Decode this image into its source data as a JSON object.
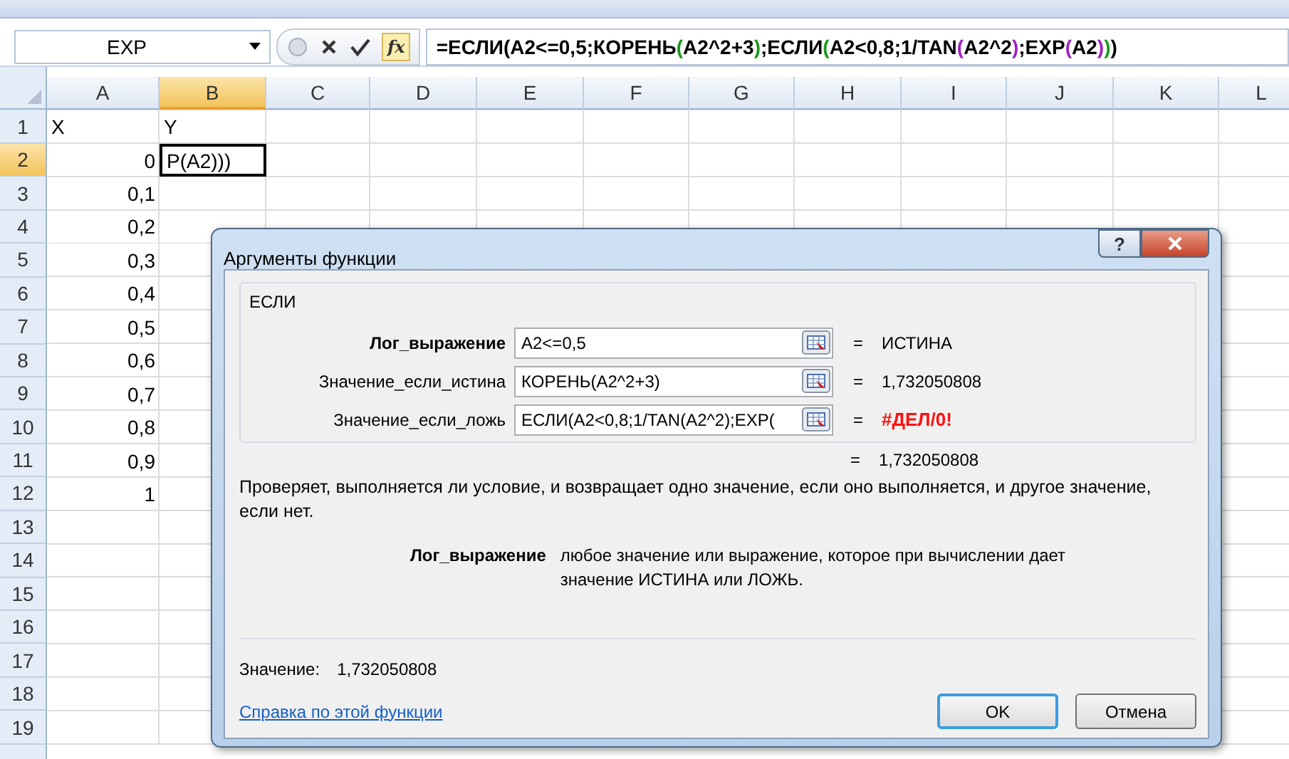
{
  "name_box": {
    "value": "EXP"
  },
  "fx_button": {
    "label": "fx"
  },
  "formula": [
    {
      "text": "=ЕСЛИ(A2<=0,5;КОРЕНЬ",
      "color": "#000000"
    },
    {
      "text": "(",
      "color": "#1a9a1a"
    },
    {
      "text": "A2^2+3",
      "color": "#000000"
    },
    {
      "text": ")",
      "color": "#1a9a1a"
    },
    {
      "text": ";ЕСЛИ",
      "color": "#000000"
    },
    {
      "text": "(",
      "color": "#1a9a1a"
    },
    {
      "text": "A2<0,8;1/TAN",
      "color": "#000000"
    },
    {
      "text": "(",
      "color": "#a020c0"
    },
    {
      "text": "A2^2",
      "color": "#000000"
    },
    {
      "text": ")",
      "color": "#a020c0"
    },
    {
      "text": ";EXP",
      "color": "#000000"
    },
    {
      "text": "(",
      "color": "#a020c0"
    },
    {
      "text": "A2",
      "color": "#000000"
    },
    {
      "text": ")",
      "color": "#a020c0"
    },
    {
      "text": ")",
      "color": "#1a9a1a"
    },
    {
      "text": ")",
      "color": "#000000"
    }
  ],
  "columns": [
    {
      "label": "A",
      "selected": false
    },
    {
      "label": "B",
      "selected": true
    },
    {
      "label": "C",
      "selected": false
    },
    {
      "label": "D",
      "selected": false
    },
    {
      "label": "E",
      "selected": false
    },
    {
      "label": "F",
      "selected": false
    },
    {
      "label": "G",
      "selected": false
    },
    {
      "label": "H",
      "selected": false
    },
    {
      "label": "I",
      "selected": false
    },
    {
      "label": "J",
      "selected": false
    },
    {
      "label": "K",
      "selected": false
    },
    {
      "label": "L",
      "selected": false
    }
  ],
  "rows": [
    {
      "header": "1",
      "selected": false,
      "cells": [
        {
          "text": "X",
          "kind": "text",
          "active": false
        },
        {
          "text": "Y",
          "kind": "text",
          "active": false
        }
      ]
    },
    {
      "header": "2",
      "selected": true,
      "cells": [
        {
          "text": "0",
          "kind": "number",
          "active": false
        },
        {
          "text": "P(A2)))",
          "kind": "text",
          "active": true
        }
      ]
    },
    {
      "header": "3",
      "selected": false,
      "cells": [
        {
          "text": "0,1",
          "kind": "number",
          "active": false
        }
      ]
    },
    {
      "header": "4",
      "selected": false,
      "cells": [
        {
          "text": "0,2",
          "kind": "number",
          "active": false
        }
      ]
    },
    {
      "header": "5",
      "selected": false,
      "cells": [
        {
          "text": "0,3",
          "kind": "number",
          "active": false
        }
      ]
    },
    {
      "header": "6",
      "selected": false,
      "cells": [
        {
          "text": "0,4",
          "kind": "number",
          "active": false
        }
      ]
    },
    {
      "header": "7",
      "selected": false,
      "cells": [
        {
          "text": "0,5",
          "kind": "number",
          "active": false
        }
      ]
    },
    {
      "header": "8",
      "selected": false,
      "cells": [
        {
          "text": "0,6",
          "kind": "number",
          "active": false
        }
      ]
    },
    {
      "header": "9",
      "selected": false,
      "cells": [
        {
          "text": "0,7",
          "kind": "number",
          "active": false
        }
      ]
    },
    {
      "header": "10",
      "selected": false,
      "cells": [
        {
          "text": "0,8",
          "kind": "number",
          "active": false
        }
      ]
    },
    {
      "header": "11",
      "selected": false,
      "cells": [
        {
          "text": "0,9",
          "kind": "number",
          "active": false
        }
      ]
    },
    {
      "header": "12",
      "selected": false,
      "cells": [
        {
          "text": "1",
          "kind": "number",
          "active": false
        }
      ]
    },
    {
      "header": "13",
      "selected": false,
      "cells": []
    },
    {
      "header": "14",
      "selected": false,
      "cells": []
    },
    {
      "header": "15",
      "selected": false,
      "cells": []
    },
    {
      "header": "16",
      "selected": false,
      "cells": []
    },
    {
      "header": "17",
      "selected": false,
      "cells": []
    },
    {
      "header": "18",
      "selected": false,
      "cells": []
    },
    {
      "header": "19",
      "selected": false,
      "cells": []
    }
  ],
  "dialog": {
    "title": "Аргументы функции",
    "help_button": "?",
    "group": "ЕСЛИ",
    "arguments": [
      {
        "label": "Лог_выражение",
        "bold": true,
        "value": "A2<=0,5",
        "equals": "=",
        "result": "ИСТИНА",
        "error": false
      },
      {
        "label": "Значение_если_истина",
        "bold": false,
        "value": "КОРЕНЬ(A2^2+3)",
        "equals": "=",
        "result": "1,732050808",
        "error": false
      },
      {
        "label": "Значение_если_ложь",
        "bold": false,
        "value": "ЕСЛИ(A2<0,8;1/TAN(A2^2);EXP(",
        "equals": "=",
        "result": "#ДЕЛ/0!",
        "error": true
      }
    ],
    "total": {
      "equals": "=",
      "result": "1,732050808"
    },
    "description": "Проверяет, выполняется ли условие, и возвращает одно значение, если оно выполняется, и другое значение, если нет.",
    "argument_help": {
      "name": "Лог_выражение",
      "text": "любое значение или выражение, которое при вычислении дает значение ИСТИНА или ЛОЖЬ."
    },
    "value_label": "Значение:",
    "value": "1,732050808",
    "help_link": "Справка по этой функции",
    "buttons": [
      {
        "label": "OK",
        "default": true
      },
      {
        "label": "Отмена",
        "default": false
      }
    ]
  }
}
